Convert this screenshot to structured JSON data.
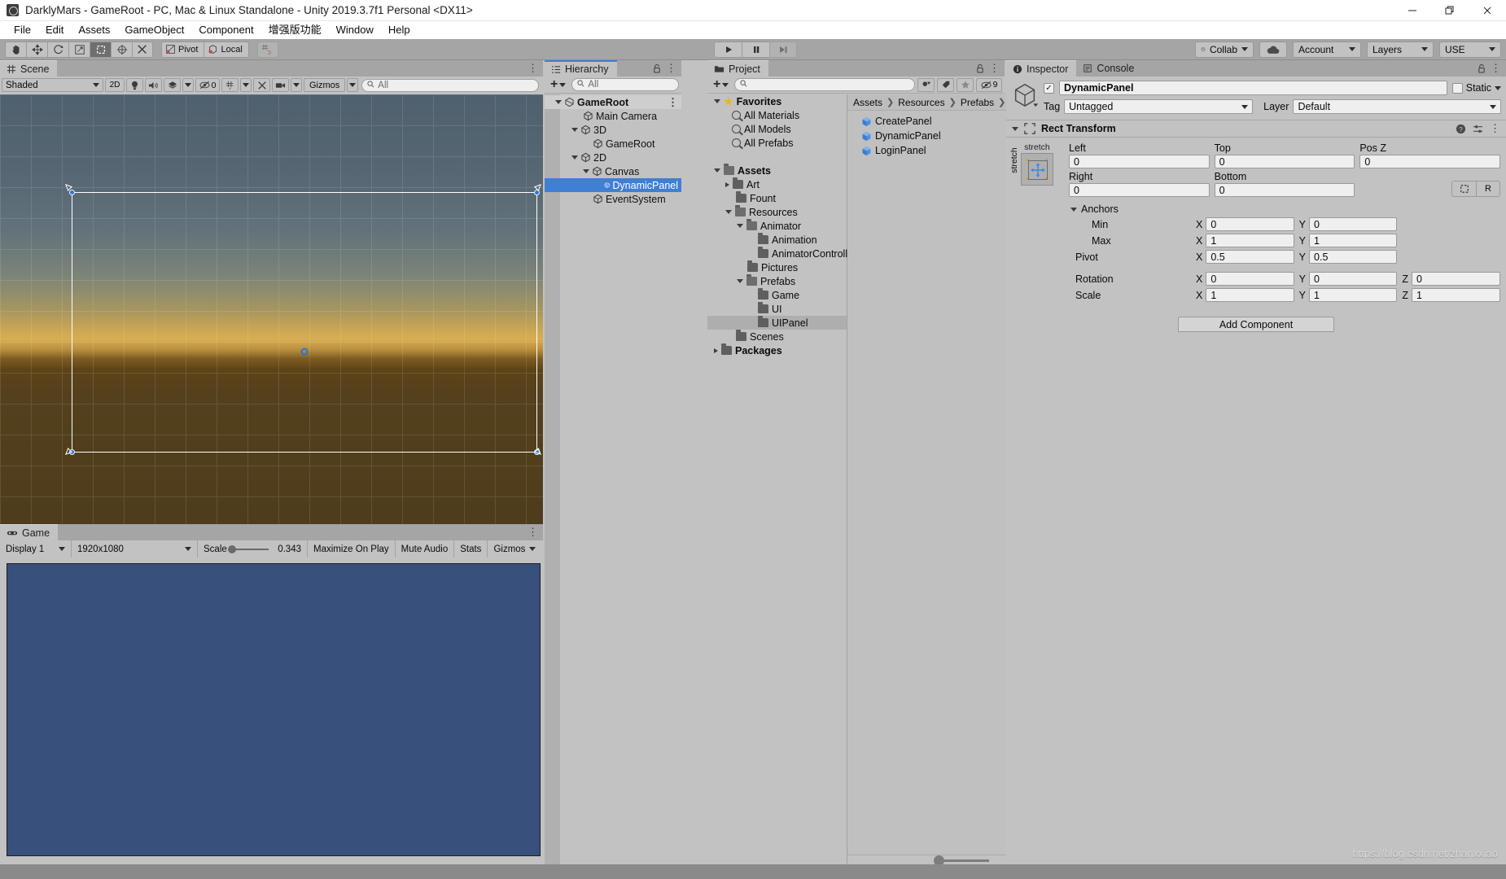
{
  "window": {
    "title": "DarklyMars - GameRoot - PC, Mac & Linux Standalone - Unity 2019.3.7f1 Personal <DX11>",
    "app_icon": "unity-icon",
    "minimize": "—",
    "maximize": "❐",
    "close": "✕"
  },
  "menubar": {
    "items": [
      {
        "label": "File",
        "name": "menu-file"
      },
      {
        "label": "Edit",
        "name": "menu-edit"
      },
      {
        "label": "Assets",
        "name": "menu-assets"
      },
      {
        "label": "GameObject",
        "name": "menu-gameobject"
      },
      {
        "label": "Component",
        "name": "menu-component"
      },
      {
        "label": "增强版功能",
        "name": "menu-enhanced"
      },
      {
        "label": "Window",
        "name": "menu-window"
      },
      {
        "label": "Help",
        "name": "menu-help"
      }
    ]
  },
  "toolbar": {
    "transform_tools": [
      {
        "name": "hand-tool",
        "icon": "hand",
        "active": false
      },
      {
        "name": "move-tool",
        "icon": "move",
        "active": false
      },
      {
        "name": "rotate-tool",
        "icon": "rotate",
        "active": false
      },
      {
        "name": "scale-tool",
        "icon": "scale",
        "active": false
      },
      {
        "name": "rect-tool",
        "icon": "rect",
        "active": true
      },
      {
        "name": "transform-tool",
        "icon": "transform",
        "active": false
      },
      {
        "name": "custom-tool",
        "icon": "wrench",
        "active": false
      }
    ],
    "pivot_label": "Pivot",
    "local_label": "Local",
    "grid_snap_name": "grid-snap-icon",
    "play_label": "▶",
    "pause_label": "‖",
    "step_label": "▶|",
    "collab_label": "Collab",
    "cloud_label": "cloud-icon",
    "account_label": "Account",
    "layers_label": "Layers",
    "layout_label": "USE"
  },
  "scene": {
    "tab_label": "Scene",
    "tab_icon": "scene-grid-icon",
    "shading_mode": "Shaded",
    "mode_2d": "2D",
    "lighting_icon": "lightbulb-icon",
    "audio_icon": "speaker-icon",
    "fx_icon": "fx-icon",
    "hidden_count": "0",
    "grid_icon": "grid-visibility-icon",
    "gizmos_tools_icon": "tools-icon",
    "camera_icon": "camera-icon",
    "gizmos_label": "Gizmos",
    "search_placeholder": "All"
  },
  "game": {
    "tab_label": "Game",
    "tab_icon": "game-pad-icon",
    "display": "Display 1",
    "aspect": "1920x1080",
    "scale_label": "Scale",
    "scale_value": "0.343",
    "maximize_label": "Maximize On Play",
    "mute_label": "Mute Audio",
    "stats_label": "Stats",
    "gizmos_label": "Gizmos",
    "bg_color": "#37517c"
  },
  "hierarchy": {
    "tab_label": "Hierarchy",
    "tab_icon": "hierarchy-icon",
    "create_label": "+",
    "search_placeholder": "All",
    "items": [
      {
        "label": "GameRoot",
        "depth": 0,
        "arrow": "open",
        "icon": "scene-icon",
        "selected": false,
        "header": true
      },
      {
        "label": "Main Camera",
        "depth": 2,
        "arrow": "none",
        "icon": "gameobject-icon",
        "selected": false
      },
      {
        "label": "3D",
        "depth": 1,
        "arrow": "open",
        "icon": "gameobject-icon",
        "selected": false
      },
      {
        "label": "GameRoot",
        "depth": 2,
        "arrow": "none",
        "icon": "gameobject-icon",
        "selected": false
      },
      {
        "label": "2D",
        "depth": 1,
        "arrow": "open",
        "icon": "gameobject-icon",
        "selected": false
      },
      {
        "label": "Canvas",
        "depth": 2,
        "arrow": "open",
        "icon": "gameobject-icon",
        "selected": false
      },
      {
        "label": "DynamicPanel",
        "depth": 3,
        "arrow": "none",
        "icon": "gameobject-icon",
        "selected": true
      },
      {
        "label": "EventSystem",
        "depth": 2,
        "arrow": "none",
        "icon": "gameobject-icon",
        "selected": false
      }
    ]
  },
  "project": {
    "tab_label": "Project",
    "tab_icon": "folder-icon",
    "create_label": "+",
    "search_placeholder": "",
    "filter_icons": [
      "type-filter-icon",
      "label-filter-icon",
      "favorite-star-icon"
    ],
    "hidden_count": "9",
    "tree": [
      {
        "label": "Favorites",
        "depth": 0,
        "arrow": "open",
        "icon": "star-icon",
        "bold": true,
        "selected": false
      },
      {
        "label": "All Materials",
        "depth": 1,
        "arrow": "none",
        "icon": "search-icon",
        "bold": false,
        "selected": false
      },
      {
        "label": "All Models",
        "depth": 1,
        "arrow": "none",
        "icon": "search-icon",
        "bold": false,
        "selected": false
      },
      {
        "label": "All Prefabs",
        "depth": 1,
        "arrow": "none",
        "icon": "search-icon",
        "bold": false,
        "selected": false
      },
      {
        "label": "",
        "depth": 0,
        "arrow": "none",
        "icon": "none",
        "bold": false,
        "selected": false
      },
      {
        "label": "Assets",
        "depth": 0,
        "arrow": "open",
        "icon": "folder-open-icon",
        "bold": true,
        "selected": false
      },
      {
        "label": "Art",
        "depth": 1,
        "arrow": "closed",
        "icon": "folder-icon",
        "bold": false,
        "selected": false
      },
      {
        "label": "Fount",
        "depth": 1,
        "arrow": "none",
        "icon": "folder-icon",
        "bold": false,
        "selected": false
      },
      {
        "label": "Resources",
        "depth": 1,
        "arrow": "open",
        "icon": "folder-open-icon",
        "bold": false,
        "selected": false
      },
      {
        "label": "Animator",
        "depth": 2,
        "arrow": "open",
        "icon": "folder-open-icon",
        "bold": false,
        "selected": false
      },
      {
        "label": "Animation",
        "depth": 3,
        "arrow": "none",
        "icon": "folder-icon",
        "bold": false,
        "selected": false
      },
      {
        "label": "AnimatorControll",
        "depth": 3,
        "arrow": "none",
        "icon": "folder-icon",
        "bold": false,
        "selected": false
      },
      {
        "label": "Pictures",
        "depth": 2,
        "arrow": "none",
        "icon": "folder-icon",
        "bold": false,
        "selected": false
      },
      {
        "label": "Prefabs",
        "depth": 2,
        "arrow": "open",
        "icon": "folder-open-icon",
        "bold": false,
        "selected": false
      },
      {
        "label": "Game",
        "depth": 3,
        "arrow": "none",
        "icon": "folder-icon",
        "bold": false,
        "selected": false
      },
      {
        "label": "UI",
        "depth": 3,
        "arrow": "none",
        "icon": "folder-icon",
        "bold": false,
        "selected": false
      },
      {
        "label": "UIPanel",
        "depth": 3,
        "arrow": "none",
        "icon": "folder-icon",
        "bold": false,
        "selected": true
      },
      {
        "label": "Scenes",
        "depth": 1,
        "arrow": "none",
        "icon": "folder-icon",
        "bold": false,
        "selected": false
      },
      {
        "label": "Packages",
        "depth": 0,
        "arrow": "closed",
        "icon": "folder-icon",
        "bold": true,
        "selected": false
      }
    ],
    "breadcrumb": [
      "Assets",
      "Resources",
      "Prefabs"
    ],
    "assets": [
      {
        "label": "CreatePanel",
        "icon": "prefab-icon"
      },
      {
        "label": "DynamicPanel",
        "icon": "prefab-icon"
      },
      {
        "label": "LoginPanel",
        "icon": "prefab-icon"
      }
    ]
  },
  "inspector": {
    "tabs": [
      {
        "label": "Inspector",
        "name": "tab-inspector",
        "icon": "info-icon",
        "active": true
      },
      {
        "label": "Console",
        "name": "tab-console",
        "icon": "console-icon",
        "active": false
      }
    ],
    "object_enabled": "✓",
    "object_name": "DynamicPanel",
    "static_label": "Static",
    "tag_label": "Tag",
    "tag_value": "Untagged",
    "layer_label": "Layer",
    "layer_value": "Default",
    "component": {
      "title": "Rect Transform",
      "help_icon": "help-icon",
      "preset_icon": "preset-icon",
      "menu_icon": "kebab-icon",
      "anchor_preset_label": "stretch",
      "anchor_preset_vertical": "stretch",
      "fields": {
        "left_label": "Left",
        "left_value": "0",
        "top_label": "Top",
        "top_value": "0",
        "posz_label": "Pos Z",
        "posz_value": "0",
        "right_label": "Right",
        "right_value": "0",
        "bottom_label": "Bottom",
        "bottom_value": "0",
        "blueprint_label": "",
        "raw_label": "R"
      },
      "anchors_label": "Anchors",
      "min_label": "Min",
      "min_x": "0",
      "min_y": "0",
      "max_label": "Max",
      "max_x": "1",
      "max_y": "1",
      "pivot_label": "Pivot",
      "pivot_x": "0.5",
      "pivot_y": "0.5",
      "rotation_label": "Rotation",
      "rot_x": "0",
      "rot_y": "0",
      "rot_z": "0",
      "scale_label": "Scale",
      "scale_x": "1",
      "scale_y": "1",
      "scale_z": "1",
      "axis_x": "X",
      "axis_y": "Y",
      "axis_z": "Z"
    },
    "add_component_label": "Add Component"
  },
  "watermark": "https://blog.csdn.net/zhanxxiao",
  "colors": {
    "selection_blue": "#3f7fd4",
    "panel_bg": "#c2c2c2",
    "toolbar_bg": "#a5a5a5",
    "game_bg": "#37517c",
    "prefab_blue": "#4a90e2"
  }
}
